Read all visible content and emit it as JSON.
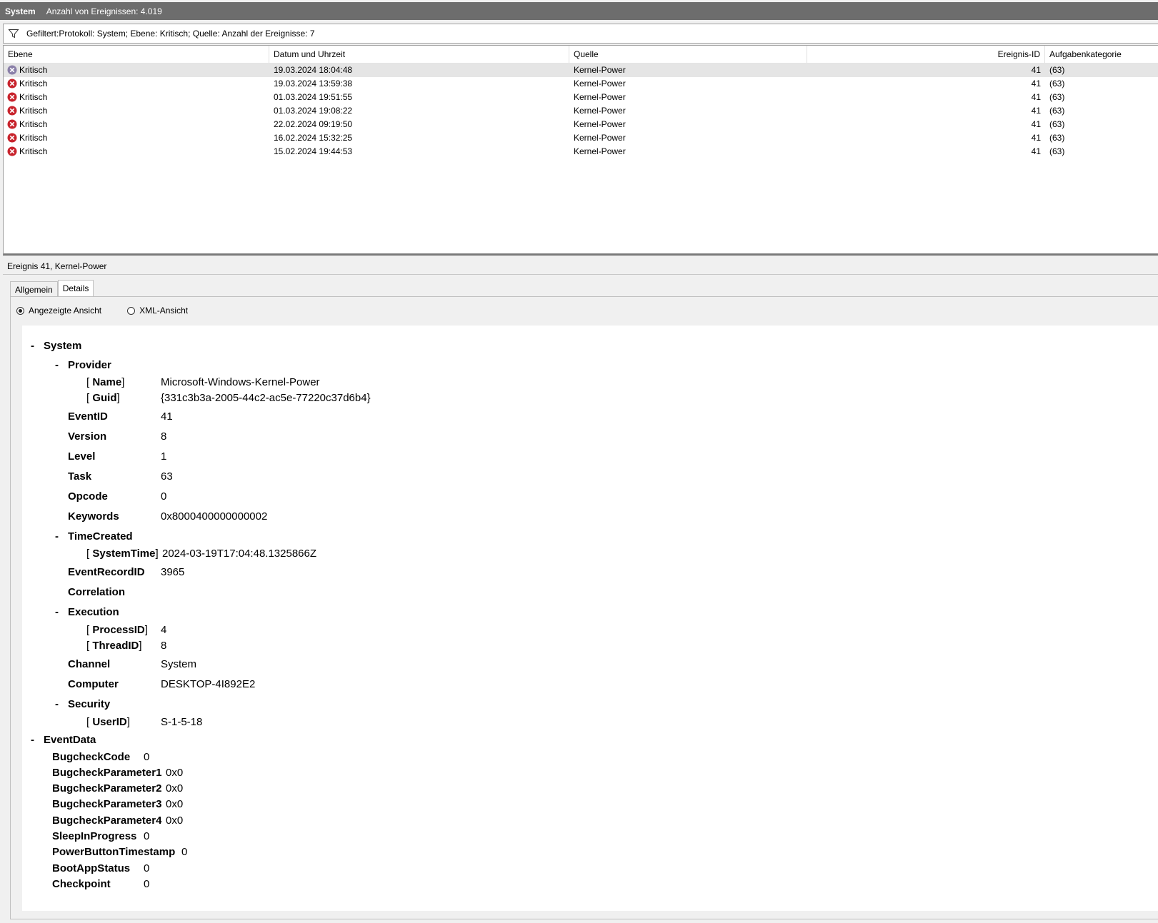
{
  "titlebar": {
    "log_name": "System",
    "event_count": "Anzahl von Ereignissen: 4.019"
  },
  "filter": {
    "text": "Gefiltert:Protokoll: System; Ebene: Kritisch; Quelle:  Anzahl der Ereignisse: 7",
    "icon": "filter-funnel-icon"
  },
  "list": {
    "columns": [
      "Ebene",
      "Datum und Uhrzeit",
      "Quelle",
      "Ereignis-ID",
      "Aufgabenkategorie"
    ],
    "rows": [
      {
        "level": "Kritisch",
        "datetime": "19.03.2024 18:04:48",
        "source": "Kernel-Power",
        "id": "41",
        "category": "(63)"
      },
      {
        "level": "Kritisch",
        "datetime": "19.03.2024 13:59:38",
        "source": "Kernel-Power",
        "id": "41",
        "category": "(63)"
      },
      {
        "level": "Kritisch",
        "datetime": "01.03.2024 19:51:55",
        "source": "Kernel-Power",
        "id": "41",
        "category": "(63)"
      },
      {
        "level": "Kritisch",
        "datetime": "01.03.2024 19:08:22",
        "source": "Kernel-Power",
        "id": "41",
        "category": "(63)"
      },
      {
        "level": "Kritisch",
        "datetime": "22.02.2024 09:19:50",
        "source": "Kernel-Power",
        "id": "41",
        "category": "(63)"
      },
      {
        "level": "Kritisch",
        "datetime": "16.02.2024 15:32:25",
        "source": "Kernel-Power",
        "id": "41",
        "category": "(63)"
      },
      {
        "level": "Kritisch",
        "datetime": "15.02.2024 19:44:53",
        "source": "Kernel-Power",
        "id": "41",
        "category": "(63)"
      }
    ]
  },
  "detail": {
    "title": "Ereignis 41, Kernel-Power",
    "tabs": [
      "Allgemein",
      "Details"
    ],
    "view_options": [
      "Angezeigte Ansicht",
      "XML-Ansicht"
    ],
    "tree": {
      "system": "System",
      "provider": "Provider",
      "name_key": "Name",
      "name_val": "Microsoft-Windows-Kernel-Power",
      "guid_key": "Guid",
      "guid_val": "{331c3b3a-2005-44c2-ac5e-77220c37d6b4}",
      "eventid_key": "EventID",
      "eventid_val": "41",
      "version_key": "Version",
      "version_val": "8",
      "level_key": "Level",
      "level_val": "1",
      "task_key": "Task",
      "task_val": "63",
      "opcode_key": "Opcode",
      "opcode_val": "0",
      "keywords_key": "Keywords",
      "keywords_val": "0x8000400000000002",
      "timecreated": "TimeCreated",
      "systemtime_key": "SystemTime",
      "systemtime_val": "2024-03-19T17:04:48.1325866Z",
      "eventrecordid_key": "EventRecordID",
      "eventrecordid_val": "3965",
      "correlation": "Correlation",
      "execution": "Execution",
      "processid_key": "ProcessID",
      "processid_val": "4",
      "threadid_key": "ThreadID",
      "threadid_val": "8",
      "channel_key": "Channel",
      "channel_val": "System",
      "computer_key": "Computer",
      "computer_val": "DESKTOP-4I892E2",
      "security": "Security",
      "userid_key": "UserID",
      "userid_val": "S-1-5-18",
      "eventdata": "EventData",
      "bugcheckcode_key": "BugcheckCode",
      "bugcheckcode_val": "0",
      "bp1_key": "BugcheckParameter1",
      "bp1_val": "0x0",
      "bp2_key": "BugcheckParameter2",
      "bp2_val": "0x0",
      "bp3_key": "BugcheckParameter3",
      "bp3_val": "0x0",
      "bp4_key": "BugcheckParameter4",
      "bp4_val": "0x0",
      "sleep_key": "SleepInProgress",
      "sleep_val": "0",
      "pbt_key": "PowerButtonTimestamp",
      "pbt_val": "0",
      "bootapp_key": "BootAppStatus",
      "bootapp_val": "0",
      "checkpoint_key": "Checkpoint",
      "checkpoint_val": "0"
    }
  }
}
